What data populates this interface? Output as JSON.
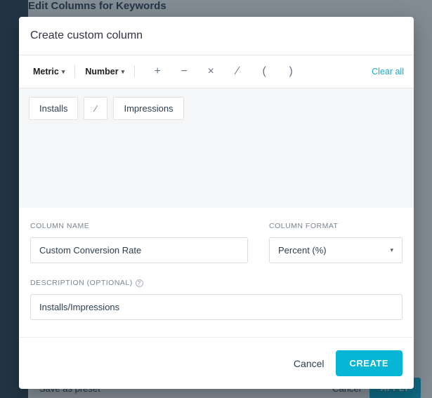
{
  "background": {
    "title": "Edit Columns for Keywords",
    "save_preset": "Save as preset",
    "cancel": "Cancel",
    "apply": "APPLY"
  },
  "modal": {
    "title": "Create custom column",
    "toolbar": {
      "metric_label": "Metric",
      "number_label": "Number",
      "clear_all": "Clear all",
      "ops": {
        "plus": "+",
        "minus": "−",
        "times": "×",
        "divide": "⁄",
        "lparen": "(",
        "rparen": ")"
      }
    },
    "canvas": {
      "chip1": "Installs",
      "op": "⁄",
      "chip2": "Impressions"
    },
    "form": {
      "column_name_label": "COLUMN NAME",
      "column_name_value": "Custom Conversion Rate",
      "column_format_label": "COLUMN FORMAT",
      "column_format_value": "Percent (%)",
      "description_label": "DESCRIPTION (OPTIONAL)",
      "description_value": "Installs/Impressions"
    },
    "footer": {
      "cancel": "Cancel",
      "create": "CREATE"
    }
  }
}
